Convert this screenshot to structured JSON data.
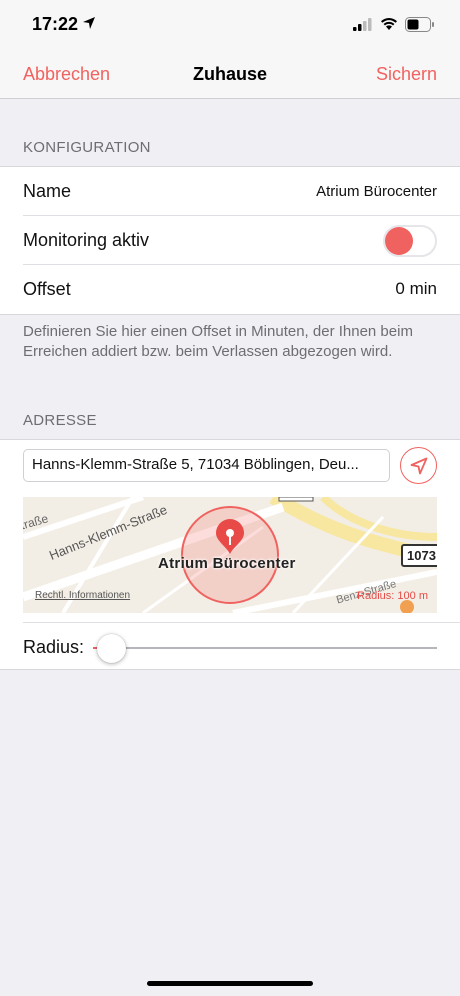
{
  "status_bar": {
    "time": "17:22"
  },
  "nav": {
    "cancel_label": "Abbrechen",
    "title": "Zuhause",
    "save_label": "Sichern",
    "accent_color": "#f0625f"
  },
  "configuration": {
    "header": "KONFIGURATION",
    "name_label": "Name",
    "name_value": "Atrium Bürocenter",
    "monitoring_label": "Monitoring aktiv",
    "monitoring_on": false,
    "offset_label": "Offset",
    "offset_value": "0 min",
    "footer_note": "Definieren Sie hier einen Offset in Minuten, der Ihnen beim Erreichen addiert bzw. beim Verlassen abgezogen wird."
  },
  "address": {
    "header": "ADRESSE",
    "value": "Hanns-Klemm-Straße 5, 71034 Böblingen, Deu...",
    "locate_icon": "location-arrow-icon"
  },
  "map": {
    "place_name": "Atrium Bürocenter",
    "road_main": "Hanns-Klemm-Straße",
    "road_partial": "traße",
    "road_right": "Benz-Straße",
    "route_badge": "1073",
    "legal_link": "Rechtl. Informationen",
    "radius_label": "Radius: 100 m",
    "pin_icon": "map-pin-icon"
  },
  "radius": {
    "label": "Radius:",
    "slider_fraction": 0.0
  }
}
